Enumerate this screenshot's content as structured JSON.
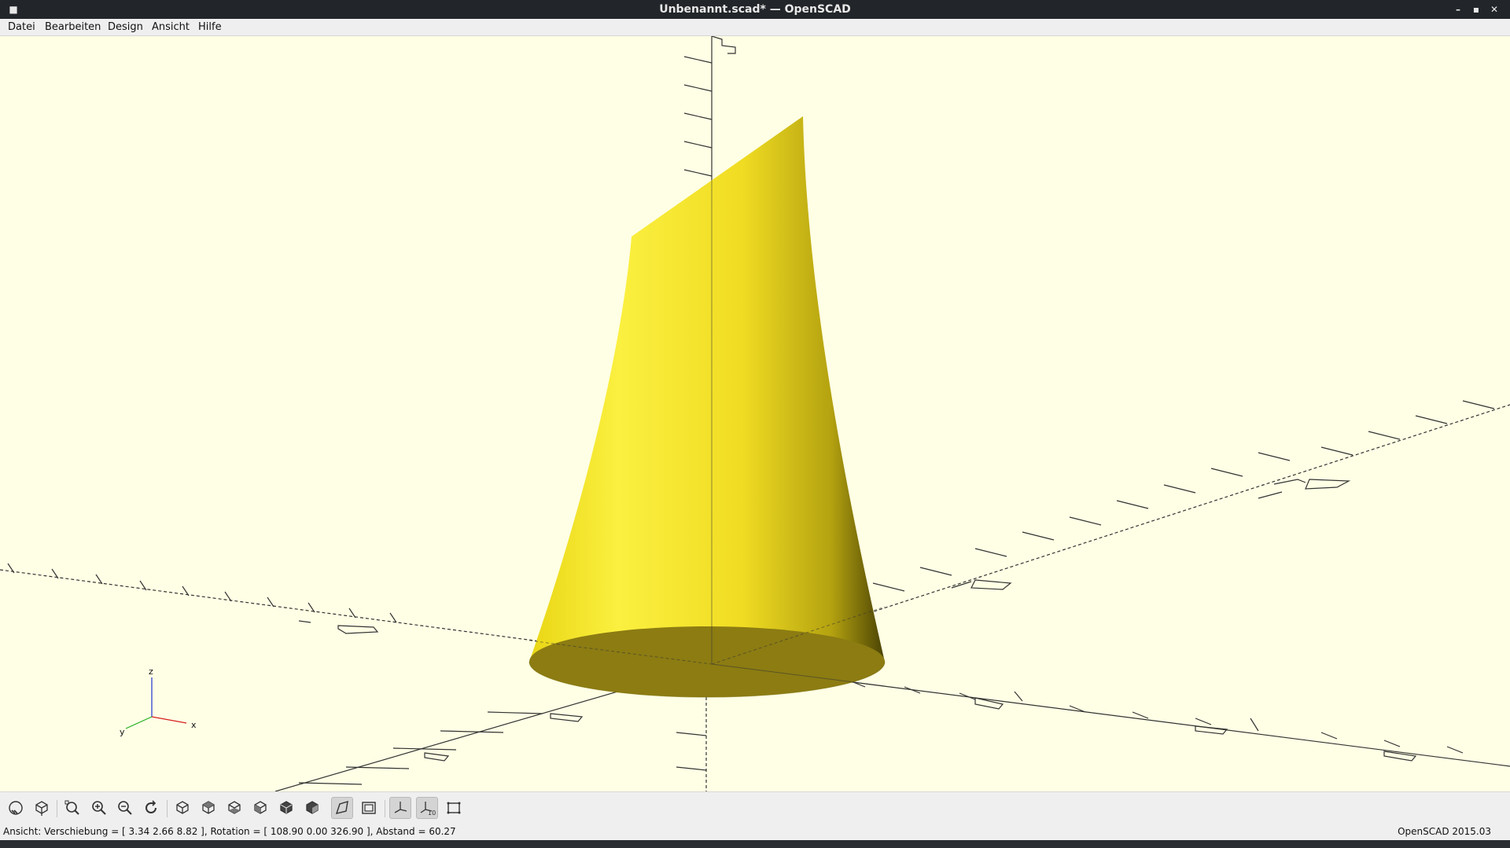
{
  "window": {
    "title": "Unbenannt.scad* — OpenSCAD",
    "buttons": [
      "minimize-icon",
      "maximize-icon",
      "close-icon"
    ]
  },
  "menu": {
    "items": [
      "Datei",
      "Bearbeiten",
      "Design",
      "Ansicht",
      "Hilfe"
    ]
  },
  "viewport": {
    "background": "#ffffe5",
    "model_color": "#f5e11f",
    "axis_labels": {
      "x": "x",
      "y": "y",
      "z": "z"
    }
  },
  "toolbar": {
    "icons": [
      "preview-icon",
      "render-icon",
      "view-all-icon",
      "zoom-in-icon",
      "zoom-out-icon",
      "reset-view-icon",
      "view-right-icon",
      "view-top-icon",
      "view-bottom-icon",
      "view-left-icon",
      "view-front-icon",
      "view-back-icon",
      "perspective-icon",
      "orthogonal-icon",
      "show-axes-icon",
      "show-scale-icon",
      "show-edges-icon"
    ]
  },
  "status": {
    "view_info": "Ansicht: Verschiebung = [ 3.34 2.66 8.82 ], Rotation = [ 108.90 0.00 326.90 ], Abstand = 60.27",
    "version": "OpenSCAD 2015.03"
  }
}
